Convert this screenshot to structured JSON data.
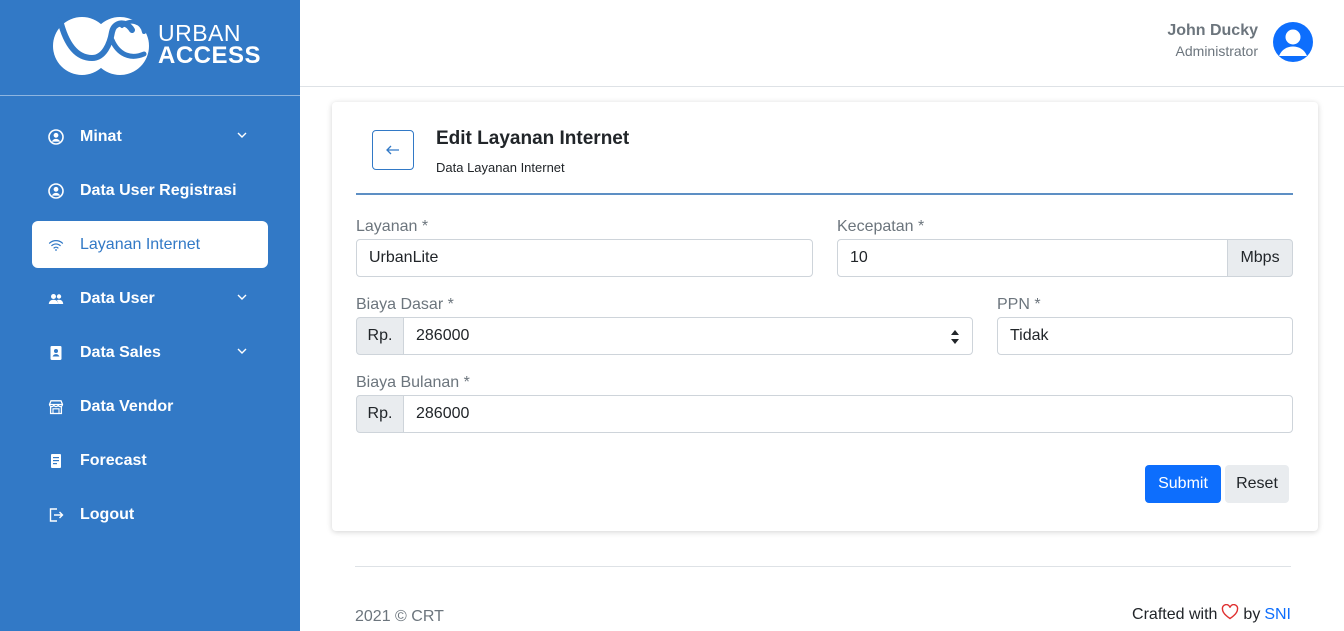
{
  "brand": {
    "line1": "URBAN",
    "line2": "ACCESS"
  },
  "sidebar": {
    "items": [
      {
        "label": "Minat",
        "icon": "user-circle-icon",
        "has_chevron": true
      },
      {
        "label": "Data User Registrasi",
        "icon": "user-circle-icon",
        "has_chevron": false
      },
      {
        "label": "Layanan Internet",
        "icon": "wifi-icon",
        "has_chevron": false,
        "active": true
      },
      {
        "label": "Data User",
        "icon": "users-icon",
        "has_chevron": true
      },
      {
        "label": "Data Sales",
        "icon": "contact-book-icon",
        "has_chevron": true
      },
      {
        "label": "Data Vendor",
        "icon": "store-icon",
        "has_chevron": false
      },
      {
        "label": "Forecast",
        "icon": "document-icon",
        "has_chevron": false
      },
      {
        "label": "Logout",
        "icon": "logout-icon",
        "has_chevron": false
      }
    ]
  },
  "header": {
    "user_name": "John Ducky",
    "user_role": "Administrator"
  },
  "card": {
    "title": "Edit Layanan Internet",
    "subtitle": "Data Layanan Internet",
    "fields": {
      "layanan": {
        "label": "Layanan *",
        "value": "UrbanLite"
      },
      "kecepatan": {
        "label": "Kecepatan *",
        "value": "10",
        "suffix": "Mbps"
      },
      "biaya_dasar": {
        "label": "Biaya Dasar *",
        "prefix": "Rp.",
        "value": "286000"
      },
      "ppn": {
        "label": "PPN *",
        "value": "Tidak"
      },
      "biaya_bulanan": {
        "label": "Biaya Bulanan *",
        "prefix": "Rp.",
        "value": "286000"
      }
    },
    "submit_label": "Submit",
    "reset_label": "Reset"
  },
  "footer": {
    "copyright": "2021 © CRT",
    "crafted": "Crafted with",
    "by": "by",
    "author": "SNI"
  },
  "colors": {
    "sidebar": "#3279c6",
    "primary": "#0d6efd",
    "heart": "#e03131"
  }
}
